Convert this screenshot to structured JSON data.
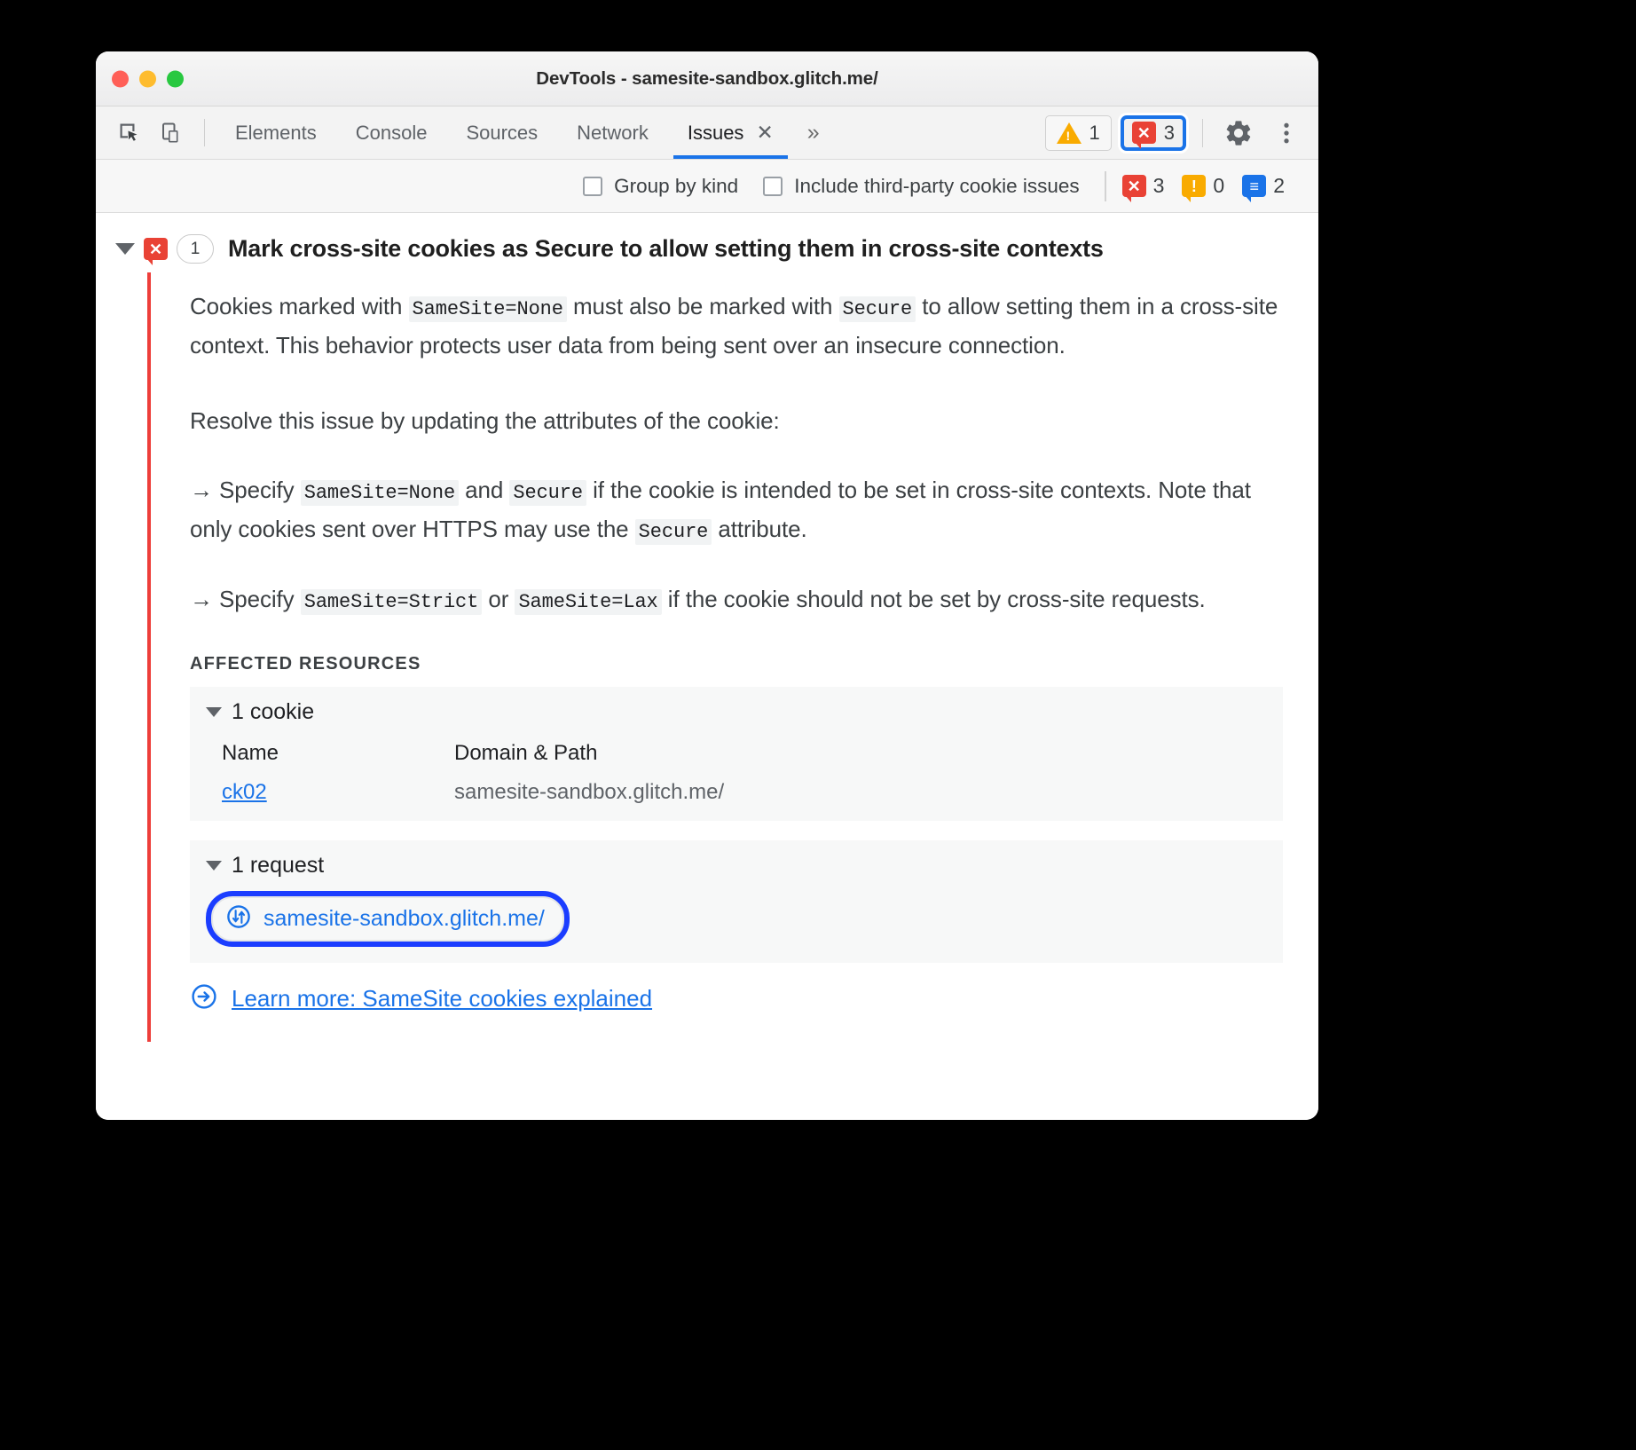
{
  "window": {
    "title": "DevTools - samesite-sandbox.glitch.me/",
    "traffic_lights": [
      "close-red",
      "minimize-yellow",
      "zoom-green"
    ]
  },
  "toolbar": {
    "inspect_icon": "inspect-element-icon",
    "device_icon": "device-toolbar-icon",
    "tabs": [
      {
        "label": "Elements",
        "active": false
      },
      {
        "label": "Console",
        "active": false
      },
      {
        "label": "Sources",
        "active": false
      },
      {
        "label": "Network",
        "active": false
      },
      {
        "label": "Issues",
        "active": true,
        "closable": true
      }
    ],
    "close_glyph": "✕",
    "more_tabs_glyph": "»",
    "warning_count": "1",
    "error_count": "3",
    "settings_icon": "gear-icon",
    "menu_icon": "kebab-menu-icon"
  },
  "filterbar": {
    "group_by_kind": {
      "label": "Group by kind",
      "checked": false
    },
    "include_third_party": {
      "label": "Include third-party cookie issues",
      "checked": false
    },
    "counts": {
      "errors": "3",
      "warnings": "0",
      "info": "2"
    }
  },
  "issue": {
    "severity": "error",
    "occurrence_count": "1",
    "title": "Mark cross-site cookies as Secure to allow setting them in cross-site contexts",
    "paragraphs": [
      {
        "id": "p1",
        "parts": [
          {
            "t": "text",
            "v": "Cookies marked with "
          },
          {
            "t": "code",
            "v": "SameSite=None"
          },
          {
            "t": "text",
            "v": " must also be marked with "
          },
          {
            "t": "code",
            "v": "Secure"
          },
          {
            "t": "text",
            "v": " to allow setting them in a cross-site context. This behavior protects user data from being sent over an insecure connection."
          }
        ]
      },
      {
        "id": "p2",
        "parts": [
          {
            "t": "text",
            "v": "Resolve this issue by updating the attributes of the cookie:"
          }
        ]
      },
      {
        "id": "p3",
        "parts": [
          {
            "t": "text",
            "v": "→ Specify "
          },
          {
            "t": "code",
            "v": "SameSite=None"
          },
          {
            "t": "text",
            "v": " and "
          },
          {
            "t": "code",
            "v": "Secure"
          },
          {
            "t": "text",
            "v": " if the cookie is intended to be set in cross-site contexts. Note that only cookies sent over HTTPS may use the "
          },
          {
            "t": "code",
            "v": "Secure"
          },
          {
            "t": "text",
            "v": " attribute."
          }
        ]
      },
      {
        "id": "p4",
        "parts": [
          {
            "t": "text",
            "v": "→ Specify "
          },
          {
            "t": "code",
            "v": "SameSite=Strict"
          },
          {
            "t": "text",
            "v": " or "
          },
          {
            "t": "code",
            "v": "SameSite=Lax"
          },
          {
            "t": "text",
            "v": " if the cookie should not be set by cross-site requests."
          }
        ]
      }
    ],
    "affected_resources_label": "AFFECTED RESOURCES",
    "cookies_section": {
      "header": "1 cookie",
      "columns": [
        "Name",
        "Domain & Path"
      ],
      "rows": [
        {
          "name": "ck02",
          "domain_path": "samesite-sandbox.glitch.me/"
        }
      ]
    },
    "requests_section": {
      "header": "1 request",
      "rows": [
        {
          "icon": "network-request-icon",
          "url": "samesite-sandbox.glitch.me/",
          "focused": true
        }
      ]
    },
    "learn_more": {
      "icon": "arrow-in-circle-icon",
      "label": "Learn more: SameSite cookies explained"
    }
  },
  "colors": {
    "error_red": "#e94235",
    "warning_orange": "#f9ab00",
    "info_blue": "#1a73e8",
    "link_blue": "#1a73e8",
    "focus_ring_blue": "#1b3dff",
    "issue_bar_red": "#ee3e3a"
  }
}
